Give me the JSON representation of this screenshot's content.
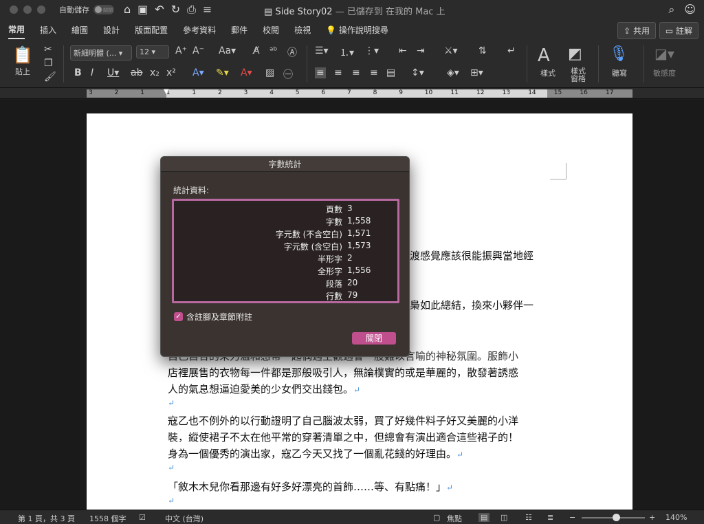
{
  "titlebar": {
    "autosave_label": "自動儲存",
    "autosave_state": "關閉",
    "doc_name": "Side Story02",
    "doc_status": "— 已儲存到 在我的 Mac 上"
  },
  "tabs": [
    "常用",
    "插入",
    "繪圖",
    "設計",
    "版面配置",
    "參考資料",
    "郵件",
    "校閱",
    "檢視"
  ],
  "tell_me": "操作說明搜尋",
  "share_label": "共用",
  "comment_label": "註解",
  "ribbon": {
    "paste_label": "貼上",
    "font_name": "新細明體 (...",
    "font_size": "12",
    "styles_label": "樣式",
    "styles_pane_label_1": "樣式",
    "styles_pane_label_2": "窗格",
    "dictate_label": "聽寫",
    "sensitivity_label": "敏感度"
  },
  "ruler_numbers": [
    "3",
    "2",
    "1",
    "1",
    "1",
    "2",
    "3",
    "4",
    "5",
    "6",
    "7",
    "8",
    "9",
    "10",
    "11",
    "12",
    "13",
    "14",
    "15",
    "16",
    "17"
  ],
  "document": {
    "lines": [
      "渡感覺應該很能振興當地經",
      "梟如此總結，換來小夥伴一",
      "自己自合的來力溫和感帶一起偶遇主觀過會一股難以言喻的神秘氛圍。服飾小",
      "店裡展售的衣物每一件都是那般吸引人，無論樸實的或是華麗的，散發著誘惑",
      "人的氣息想逼迫愛美的少女們交出錢包。",
      "寇乙也不例外的以行動證明了自己腦波太弱，買了好幾件料子好又美麗的小洋",
      "裝，縱使裙子不太在他平常的穿著清單之中，但總會有演出適合這些裙子的！",
      "身為一個優秀的演出家，寇乙今天又找了一個亂花錢的好理由。",
      "「敘木木兒你看那邊有好多好漂亮的首飾……等、有點痛！」"
    ]
  },
  "dialog": {
    "title": "字數統計",
    "section_label": "統計資料:",
    "stats": [
      {
        "label": "頁數",
        "value": "3"
      },
      {
        "label": "字數",
        "value": "1,558"
      },
      {
        "label": "字元數 (不含空白)",
        "value": "1,571"
      },
      {
        "label": "字元數 (含空白)",
        "value": "1,573"
      },
      {
        "label": "半形字",
        "value": "2"
      },
      {
        "label": "全形字",
        "value": "1,556"
      },
      {
        "label": "段落",
        "value": "20"
      },
      {
        "label": "行數",
        "value": "79"
      }
    ],
    "checkbox_label": "含註腳及章節附註",
    "checkbox_checked": true,
    "close_label": "關閉",
    "accent_color": "#c04f8d"
  },
  "statusbar": {
    "page_info": "第 1 頁，共 3 頁",
    "word_count": "1558 個字",
    "language": "中文 (台灣)",
    "focus_label": "焦點",
    "zoom": "140%",
    "zoom_level_percent": 140
  }
}
